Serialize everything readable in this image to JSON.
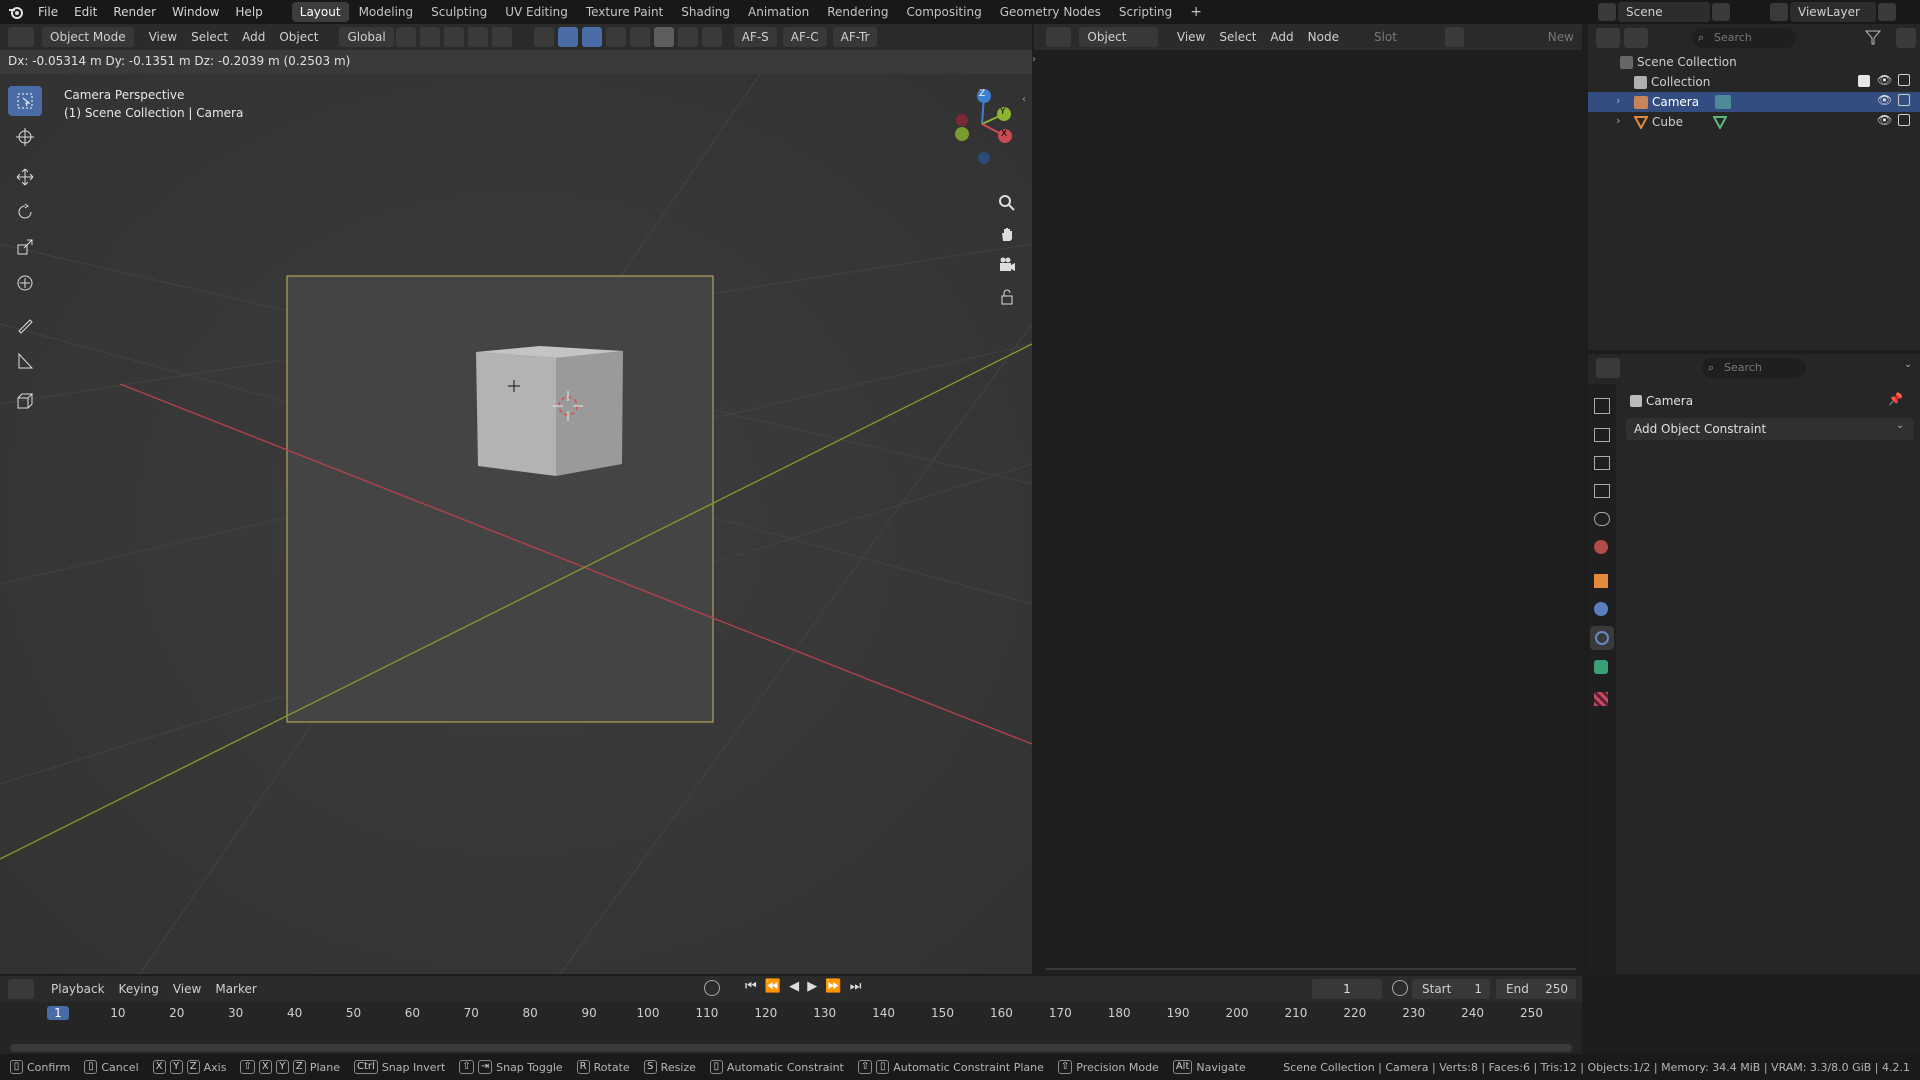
{
  "menubar": {
    "menus": [
      "File",
      "Edit",
      "Render",
      "Window",
      "Help"
    ],
    "workspaces": [
      "Layout",
      "Modeling",
      "Sculpting",
      "UV Editing",
      "Texture Paint",
      "Shading",
      "Animation",
      "Rendering",
      "Compositing",
      "Geometry Nodes",
      "Scripting"
    ],
    "active_workspace": "Layout",
    "scene_name": "Scene",
    "view_layer": "ViewLayer"
  },
  "viewport_header": {
    "mode": "Object Mode",
    "menus": [
      "View",
      "Select",
      "Add",
      "Object"
    ],
    "transform_orientation": "Global",
    "af_labels": [
      "AF-S",
      "AF-C",
      "AF-Tr"
    ]
  },
  "hud": "Dx: -0.05314 m  Dy: -0.1351 m  Dz: -0.2039 m (0.2503 m)",
  "viewport_overlay": {
    "line1": "Camera Perspective",
    "line2": "(1) Scene Collection | Camera"
  },
  "gizmo": {
    "z": "Z",
    "y": "Y",
    "x": "X"
  },
  "node_header": {
    "type": "Object",
    "menus": [
      "View",
      "Select",
      "Add",
      "Node"
    ],
    "slot": "Slot",
    "new_label": "New"
  },
  "outliner": {
    "search_placeholder": "Search",
    "root": "Scene Collection",
    "items": [
      {
        "label": "Collection"
      },
      {
        "label": "Camera"
      },
      {
        "label": "Cube"
      }
    ]
  },
  "properties": {
    "search_placeholder": "Search",
    "object_name": "Camera",
    "add_constraint_label": "Add Object Constraint"
  },
  "timeline": {
    "menus": [
      "Playback",
      "Keying",
      "View",
      "Marker"
    ],
    "current_frame": "1",
    "start_label": "Start",
    "start_value": "1",
    "end_label": "End",
    "end_value": "250",
    "ruler": [
      "1",
      "10",
      "20",
      "30",
      "40",
      "50",
      "60",
      "70",
      "80",
      "90",
      "100",
      "110",
      "120",
      "130",
      "140",
      "150",
      "160",
      "170",
      "180",
      "190",
      "200",
      "210",
      "220",
      "230",
      "240",
      "250"
    ]
  },
  "statusbar": {
    "confirm": "Confirm",
    "cancel": "Cancel",
    "axis": "Axis",
    "plane": "Plane",
    "snap_invert": "Snap Invert",
    "snap_toggle": "Snap Toggle",
    "rotate": "Rotate",
    "resize": "Resize",
    "auto_constraint": "Automatic Constraint",
    "auto_constraint_plane": "Automatic Constraint Plane",
    "precision": "Precision Mode",
    "navigate": "Navigate",
    "info": "Scene Collection | Camera | Verts:8 | Faces:6 | Tris:12 | Objects:1/2 | Memory: 34.4 MiB | VRAM: 3.3/8.0 GiB | 4.2.1"
  },
  "colors": {
    "accent": "#4a6ca6",
    "selected_row": "#334d80",
    "x_axis": "#c84b55",
    "y_axis": "#8bb530",
    "z_axis": "#3d7fd0"
  }
}
